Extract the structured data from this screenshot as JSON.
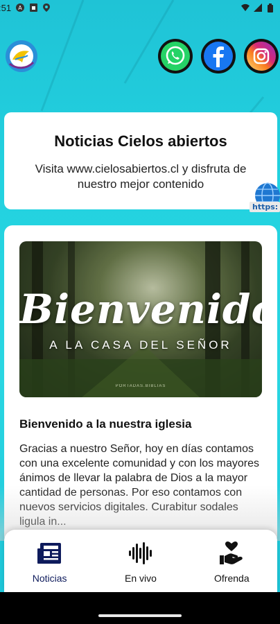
{
  "status_bar": {
    "time": ":51",
    "icons": [
      "a-icon",
      "sim-icon",
      "location-icon",
      "wifi-icon",
      "signal-icon",
      "battery-icon"
    ]
  },
  "header": {
    "logo": "church-dove-logo",
    "social": [
      "whatsapp-icon",
      "facebook-icon",
      "instagram-icon"
    ]
  },
  "news_card": {
    "title": "Noticias Cielos abiertos",
    "text": "Visita www.cielosabiertos.cl y disfruta de nuestro mejor contenido",
    "badge_text": "https:"
  },
  "post": {
    "hero_title": "Bienvenidos",
    "hero_subtitle": "A LA CASA DEL SEÑOR",
    "hero_watermark": "PORTADAS.BIBLIAS",
    "title": "Bienvenido a la nuestra iglesia",
    "body": "Gracias a nuestro Señor, hoy en días contamos con una excelente comunidad y con los mayores ánimos de llevar la palabra de Dios a la mayor cantidad de personas. Por eso contamos con nuevos servicios digitales. Curabitur sodales ligula in..."
  },
  "bottom_nav": {
    "items": [
      {
        "label": "Noticias",
        "icon": "newspaper-icon",
        "active": true
      },
      {
        "label": "En vivo",
        "icon": "audio-wave-icon",
        "active": false
      },
      {
        "label": "Ofrenda",
        "icon": "heart-hand-icon",
        "active": false
      }
    ]
  },
  "colors": {
    "background": "#1fc3d6",
    "accent": "#0e1b5c",
    "whatsapp": "#25d366",
    "facebook": "#1877f2",
    "instagram": "#e1306c"
  }
}
